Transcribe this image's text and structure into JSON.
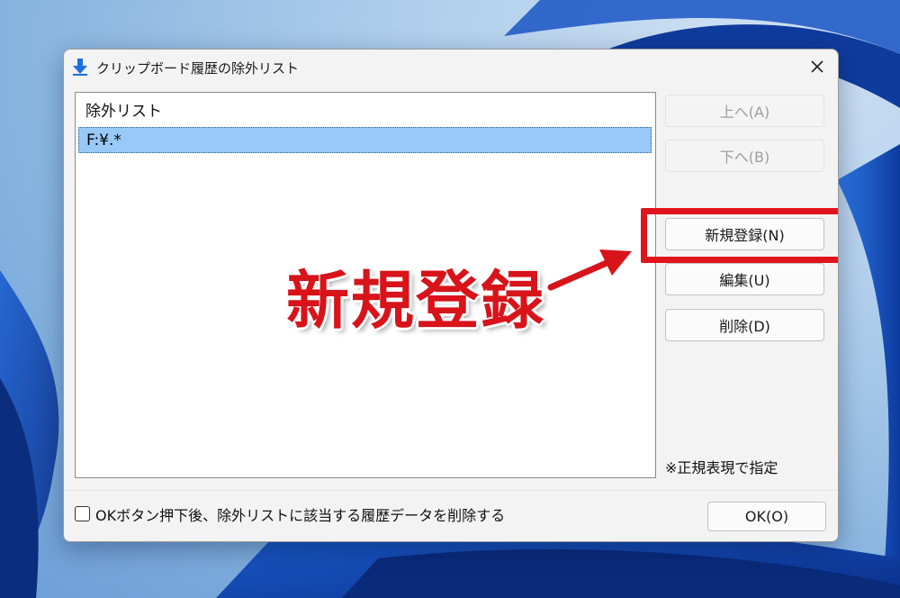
{
  "window": {
    "title": "クリップボード履歴の除外リスト",
    "icon": "download-arrow-icon",
    "close_label": "✕"
  },
  "list": {
    "header": "除外リスト",
    "items": [
      {
        "value": "F:¥.*",
        "selected": true
      }
    ]
  },
  "buttons": {
    "up": {
      "label": "上へ(A)",
      "enabled": false
    },
    "down": {
      "label": "下へ(B)",
      "enabled": false
    },
    "new": {
      "label": "新規登録(N)",
      "enabled": true
    },
    "edit": {
      "label": "編集(U)",
      "enabled": true
    },
    "delete": {
      "label": "削除(D)",
      "enabled": true
    },
    "ok": {
      "label": "OK(O)",
      "enabled": true
    }
  },
  "note": "※正規表現で指定",
  "footer": {
    "checkbox_label": "OKボタン押下後、除外リストに該当する履歴データを削除する",
    "checkbox_checked": false
  },
  "annotation": {
    "text": "新規登録",
    "color": "#d8131a"
  }
}
